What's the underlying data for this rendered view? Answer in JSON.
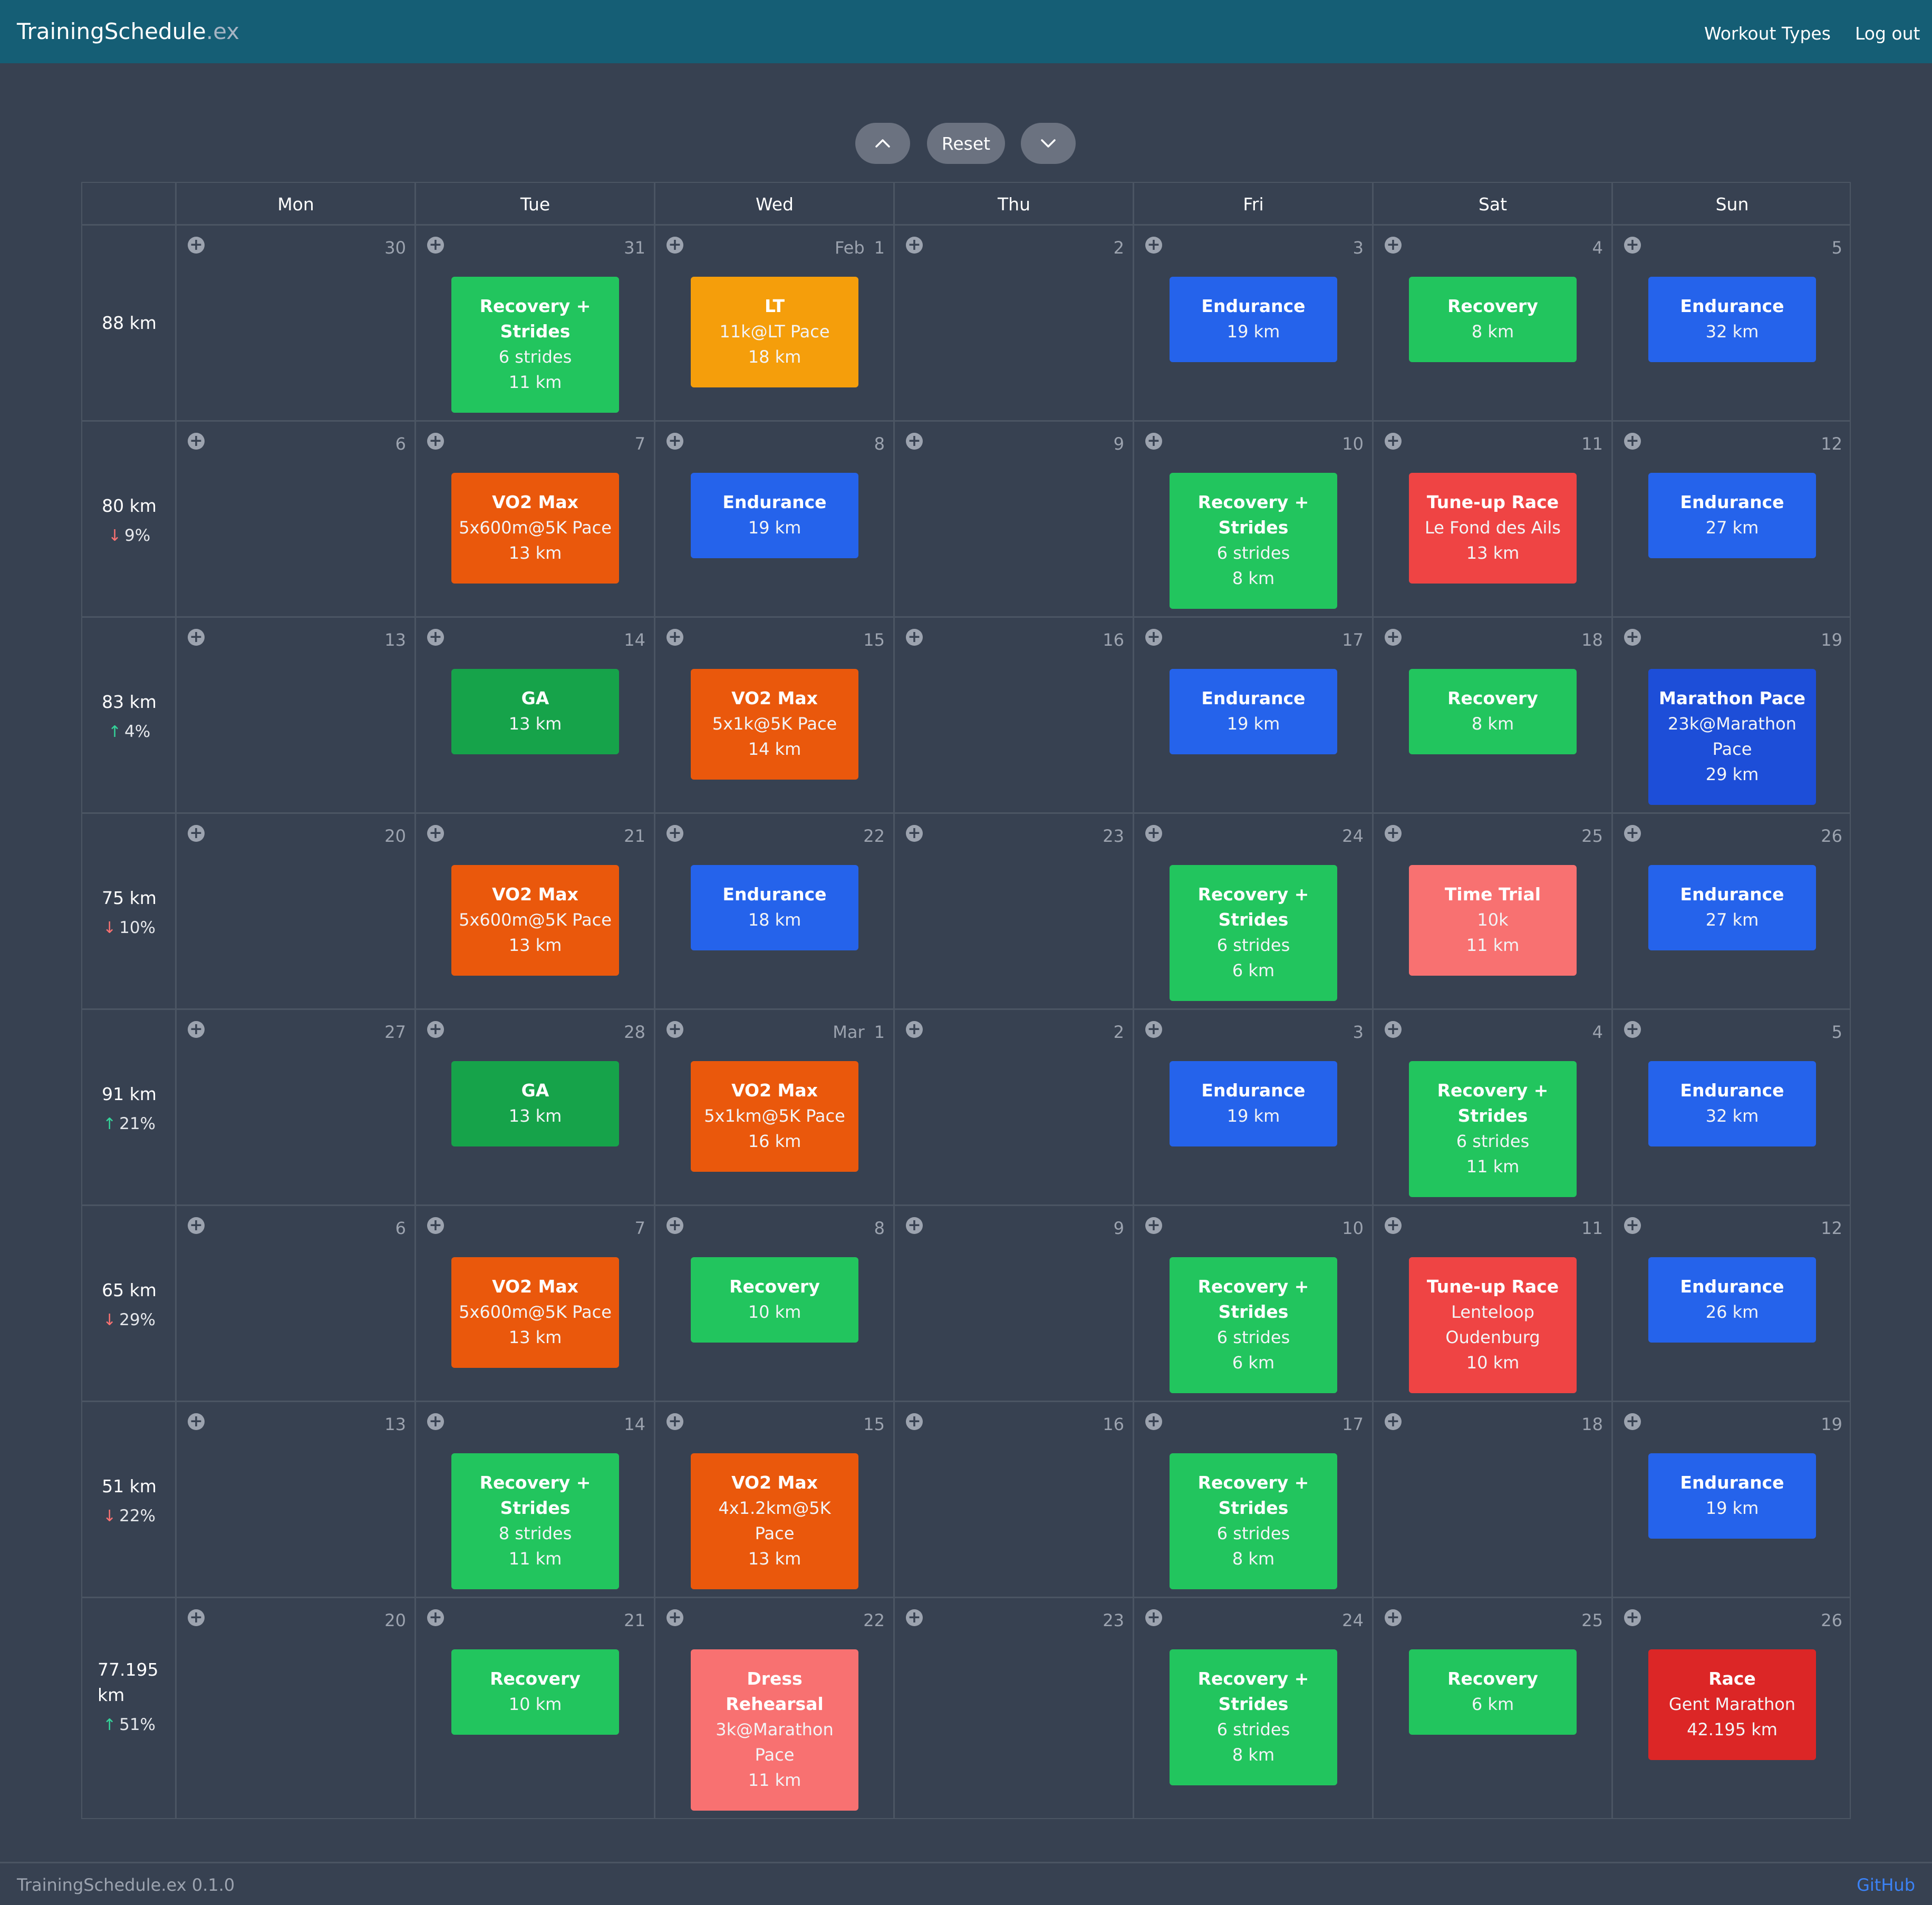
{
  "app": {
    "title": "TrainingSchedule",
    "title_ext": ".ex"
  },
  "nav": {
    "workout_types": "Workout Types",
    "logout": "Log out"
  },
  "controls": {
    "up_icon": "chevron-up-icon",
    "reset": "Reset",
    "down_icon": "chevron-down-icon"
  },
  "days": [
    "Mon",
    "Tue",
    "Wed",
    "Thu",
    "Fri",
    "Sat",
    "Sun"
  ],
  "colors": {
    "navbar": "#155e75",
    "background": "#374151",
    "recovery": "#22c55e",
    "ga": "#16a34a",
    "endurance": "#2563eb",
    "marathon_pace": "#1d4ed8",
    "lt": "#f59e0b",
    "vo2max": "#ea580c",
    "tune_up_race": "#ef4444",
    "time_trial": "#f87171",
    "dress_rehearsal": "#f87171",
    "race": "#dc2626"
  },
  "weeks": [
    {
      "total": "88 km",
      "change": "",
      "dir": "",
      "days": [
        {
          "date": "30",
          "month": "",
          "workout": null
        },
        {
          "date": "31",
          "month": "",
          "workout": {
            "title": "Recovery + Strides",
            "lines": [
              "6 strides",
              "11 km"
            ],
            "color": "#22c55e"
          }
        },
        {
          "date": "1",
          "month": "Feb",
          "workout": {
            "title": "LT",
            "lines": [
              "11k@LT Pace",
              "18 km"
            ],
            "color": "#f59e0b"
          }
        },
        {
          "date": "2",
          "month": "",
          "workout": null
        },
        {
          "date": "3",
          "month": "",
          "workout": {
            "title": "Endurance",
            "lines": [
              "19 km"
            ],
            "color": "#2563eb"
          }
        },
        {
          "date": "4",
          "month": "",
          "workout": {
            "title": "Recovery",
            "lines": [
              "8 km"
            ],
            "color": "#22c55e"
          }
        },
        {
          "date": "5",
          "month": "",
          "workout": {
            "title": "Endurance",
            "lines": [
              "32 km"
            ],
            "color": "#2563eb"
          }
        }
      ]
    },
    {
      "total": "80 km",
      "change": "9%",
      "dir": "down",
      "days": [
        {
          "date": "6",
          "month": "",
          "workout": null
        },
        {
          "date": "7",
          "month": "",
          "workout": {
            "title": "VO2 Max",
            "lines": [
              "5x600m@5K Pace",
              "13 km"
            ],
            "color": "#ea580c"
          }
        },
        {
          "date": "8",
          "month": "",
          "workout": {
            "title": "Endurance",
            "lines": [
              "19 km"
            ],
            "color": "#2563eb"
          }
        },
        {
          "date": "9",
          "month": "",
          "workout": null
        },
        {
          "date": "10",
          "month": "",
          "workout": {
            "title": "Recovery + Strides",
            "lines": [
              "6 strides",
              "8 km"
            ],
            "color": "#22c55e"
          }
        },
        {
          "date": "11",
          "month": "",
          "workout": {
            "title": "Tune-up Race",
            "lines": [
              "Le Fond des Ails",
              "13 km"
            ],
            "color": "#ef4444"
          }
        },
        {
          "date": "12",
          "month": "",
          "workout": {
            "title": "Endurance",
            "lines": [
              "27 km"
            ],
            "color": "#2563eb"
          }
        }
      ]
    },
    {
      "total": "83 km",
      "change": "4%",
      "dir": "up",
      "days": [
        {
          "date": "13",
          "month": "",
          "workout": null
        },
        {
          "date": "14",
          "month": "",
          "workout": {
            "title": "GA",
            "lines": [
              "13 km"
            ],
            "color": "#16a34a"
          }
        },
        {
          "date": "15",
          "month": "",
          "workout": {
            "title": "VO2 Max",
            "lines": [
              "5x1k@5K Pace",
              "14 km"
            ],
            "color": "#ea580c"
          }
        },
        {
          "date": "16",
          "month": "",
          "workout": null
        },
        {
          "date": "17",
          "month": "",
          "workout": {
            "title": "Endurance",
            "lines": [
              "19 km"
            ],
            "color": "#2563eb"
          }
        },
        {
          "date": "18",
          "month": "",
          "workout": {
            "title": "Recovery",
            "lines": [
              "8 km"
            ],
            "color": "#22c55e"
          }
        },
        {
          "date": "19",
          "month": "",
          "workout": {
            "title": "Marathon Pace",
            "lines": [
              "23k@Marathon Pace",
              "29 km"
            ],
            "color": "#1d4ed8"
          }
        }
      ]
    },
    {
      "total": "75 km",
      "change": "10%",
      "dir": "down",
      "days": [
        {
          "date": "20",
          "month": "",
          "workout": null
        },
        {
          "date": "21",
          "month": "",
          "workout": {
            "title": "VO2 Max",
            "lines": [
              "5x600m@5K Pace",
              "13 km"
            ],
            "color": "#ea580c"
          }
        },
        {
          "date": "22",
          "month": "",
          "workout": {
            "title": "Endurance",
            "lines": [
              "18 km"
            ],
            "color": "#2563eb"
          }
        },
        {
          "date": "23",
          "month": "",
          "workout": null
        },
        {
          "date": "24",
          "month": "",
          "workout": {
            "title": "Recovery + Strides",
            "lines": [
              "6 strides",
              "6 km"
            ],
            "color": "#22c55e"
          }
        },
        {
          "date": "25",
          "month": "",
          "workout": {
            "title": "Time Trial",
            "lines": [
              "10k",
              "11 km"
            ],
            "color": "#f87171"
          }
        },
        {
          "date": "26",
          "month": "",
          "workout": {
            "title": "Endurance",
            "lines": [
              "27 km"
            ],
            "color": "#2563eb"
          }
        }
      ]
    },
    {
      "total": "91 km",
      "change": "21%",
      "dir": "up",
      "days": [
        {
          "date": "27",
          "month": "",
          "workout": null
        },
        {
          "date": "28",
          "month": "",
          "workout": {
            "title": "GA",
            "lines": [
              "13 km"
            ],
            "color": "#16a34a"
          }
        },
        {
          "date": "1",
          "month": "Mar",
          "workout": {
            "title": "VO2 Max",
            "lines": [
              "5x1km@5K Pace",
              "16 km"
            ],
            "color": "#ea580c"
          }
        },
        {
          "date": "2",
          "month": "",
          "workout": null
        },
        {
          "date": "3",
          "month": "",
          "workout": {
            "title": "Endurance",
            "lines": [
              "19 km"
            ],
            "color": "#2563eb"
          }
        },
        {
          "date": "4",
          "month": "",
          "workout": {
            "title": "Recovery + Strides",
            "lines": [
              "6 strides",
              "11 km"
            ],
            "color": "#22c55e"
          }
        },
        {
          "date": "5",
          "month": "",
          "workout": {
            "title": "Endurance",
            "lines": [
              "32 km"
            ],
            "color": "#2563eb"
          }
        }
      ]
    },
    {
      "total": "65 km",
      "change": "29%",
      "dir": "down",
      "days": [
        {
          "date": "6",
          "month": "",
          "workout": null
        },
        {
          "date": "7",
          "month": "",
          "workout": {
            "title": "VO2 Max",
            "lines": [
              "5x600m@5K Pace",
              "13 km"
            ],
            "color": "#ea580c"
          }
        },
        {
          "date": "8",
          "month": "",
          "workout": {
            "title": "Recovery",
            "lines": [
              "10 km"
            ],
            "color": "#22c55e"
          }
        },
        {
          "date": "9",
          "month": "",
          "workout": null
        },
        {
          "date": "10",
          "month": "",
          "workout": {
            "title": "Recovery + Strides",
            "lines": [
              "6 strides",
              "6 km"
            ],
            "color": "#22c55e"
          }
        },
        {
          "date": "11",
          "month": "",
          "workout": {
            "title": "Tune-up Race",
            "lines": [
              "Lenteloop Oudenburg",
              "10 km"
            ],
            "color": "#ef4444"
          }
        },
        {
          "date": "12",
          "month": "",
          "workout": {
            "title": "Endurance",
            "lines": [
              "26 km"
            ],
            "color": "#2563eb"
          }
        }
      ]
    },
    {
      "total": "51 km",
      "change": "22%",
      "dir": "down",
      "days": [
        {
          "date": "13",
          "month": "",
          "workout": null
        },
        {
          "date": "14",
          "month": "",
          "workout": {
            "title": "Recovery + Strides",
            "lines": [
              "8 strides",
              "11 km"
            ],
            "color": "#22c55e"
          }
        },
        {
          "date": "15",
          "month": "",
          "workout": {
            "title": "VO2 Max",
            "lines": [
              "4x1.2km@5K Pace",
              "13 km"
            ],
            "color": "#ea580c"
          }
        },
        {
          "date": "16",
          "month": "",
          "workout": null
        },
        {
          "date": "17",
          "month": "",
          "workout": {
            "title": "Recovery + Strides",
            "lines": [
              "6 strides",
              "8 km"
            ],
            "color": "#22c55e"
          }
        },
        {
          "date": "18",
          "month": "",
          "workout": null
        },
        {
          "date": "19",
          "month": "",
          "workout": {
            "title": "Endurance",
            "lines": [
              "19 km"
            ],
            "color": "#2563eb"
          }
        }
      ]
    },
    {
      "total": "77.195 km",
      "change": "51%",
      "dir": "up",
      "days": [
        {
          "date": "20",
          "month": "",
          "workout": null
        },
        {
          "date": "21",
          "month": "",
          "workout": {
            "title": "Recovery",
            "lines": [
              "10 km"
            ],
            "color": "#22c55e"
          }
        },
        {
          "date": "22",
          "month": "",
          "workout": {
            "title": "Dress Rehearsal",
            "lines": [
              "3k@Marathon Pace",
              "11 km"
            ],
            "color": "#f87171"
          }
        },
        {
          "date": "23",
          "month": "",
          "workout": null
        },
        {
          "date": "24",
          "month": "",
          "workout": {
            "title": "Recovery + Strides",
            "lines": [
              "6 strides",
              "8 km"
            ],
            "color": "#22c55e"
          }
        },
        {
          "date": "25",
          "month": "",
          "workout": {
            "title": "Recovery",
            "lines": [
              "6 km"
            ],
            "color": "#22c55e"
          }
        },
        {
          "date": "26",
          "month": "",
          "workout": {
            "title": "Race",
            "lines": [
              "Gent Marathon",
              "42.195 km"
            ],
            "color": "#dc2626"
          }
        }
      ]
    }
  ],
  "footer": {
    "version": "TrainingSchedule.ex 0.1.0",
    "github": "GitHub"
  }
}
